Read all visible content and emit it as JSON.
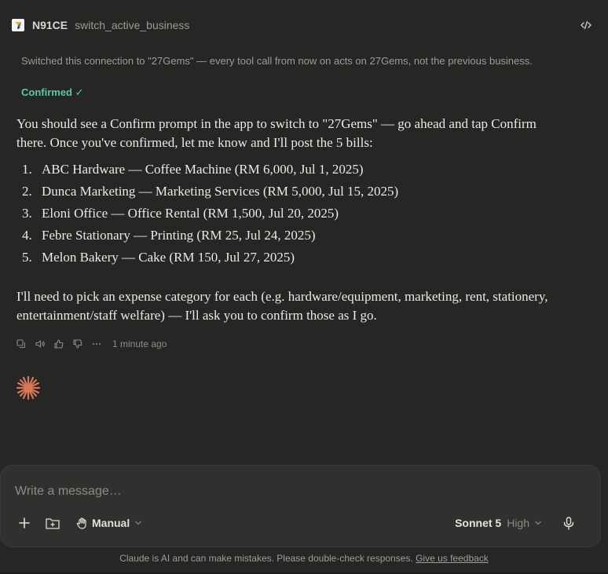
{
  "tool_call": {
    "app_name": "N91CE",
    "tool_name": "switch_active_business",
    "result_text": "Switched this connection to \"27Gems\" — every tool call from now on acts on 27Gems, not the previous business.",
    "status": "Confirmed ✓"
  },
  "message": {
    "intro": "You should see a Confirm prompt in the app to switch to \"27Gems\" — go ahead and tap Confirm there. Once you've confirmed, let me know and I'll post the 5 bills:",
    "bills": [
      {
        "num": "1.",
        "text": "ABC Hardware — Coffee Machine (RM 6,000, Jul 1, 2025)"
      },
      {
        "num": "2.",
        "text": "Dunca Marketing — Marketing Services (RM 5,000, Jul 15, 2025)"
      },
      {
        "num": "3.",
        "text": "Eloni Office — Office Rental (RM 1,500, Jul 20, 2025)"
      },
      {
        "num": "4.",
        "text": "Febre Stationary — Printing (RM 25, Jul 24, 2025)"
      },
      {
        "num": "5.",
        "text": "Melon Bakery — Cake (RM 150, Jul 27, 2025)"
      }
    ],
    "outro": "I'll need to pick an expense category for each (e.g. hardware/equipment, marketing, rent, stationery, entertainment/staff welfare) — I'll ask you to confirm those as I go.",
    "timestamp": "1 minute ago"
  },
  "composer": {
    "placeholder": "Write a message…",
    "mode_label": "Manual",
    "model_name": "Sonnet 5",
    "effort_label": "High"
  },
  "footer": {
    "disclaimer": "Claude is AI and can make mistakes. Please double-check responses.",
    "feedback_link": "Give us feedback"
  },
  "colors": {
    "background": "#262624",
    "confirmed": "#5cc9a0",
    "spinner": "#d97757"
  }
}
